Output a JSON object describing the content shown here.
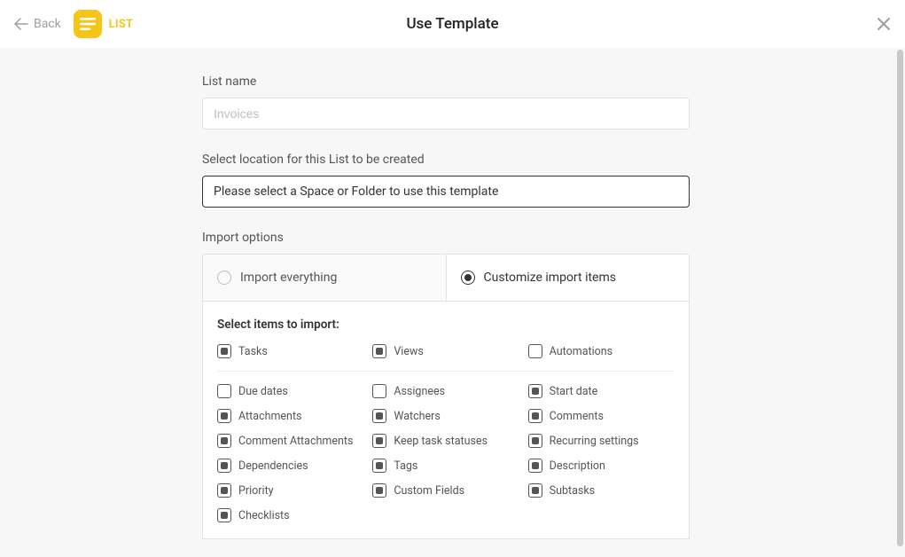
{
  "header": {
    "back_label": "Back",
    "chip_label": "LIST",
    "title": "Use Template"
  },
  "form": {
    "list_name_label": "List name",
    "list_name_placeholder": "Invoices",
    "location_label": "Select location for this List to be created",
    "location_placeholder": "Please select a Space or Folder to use this template"
  },
  "import": {
    "options_label": "Import options",
    "everything_label": "Import everything",
    "customize_label": "Customize import items",
    "select_items_label": "Select items to import:",
    "top_row": [
      {
        "label": "Tasks",
        "checked": true
      },
      {
        "label": "Views",
        "checked": true
      },
      {
        "label": "Automations",
        "checked": false
      }
    ],
    "cols": [
      [
        {
          "label": "Due dates",
          "checked": false
        },
        {
          "label": "Attachments",
          "checked": true
        },
        {
          "label": "Comment Attachments",
          "checked": true
        },
        {
          "label": "Dependencies",
          "checked": true
        },
        {
          "label": "Priority",
          "checked": true
        },
        {
          "label": "Checklists",
          "checked": true
        }
      ],
      [
        {
          "label": "Assignees",
          "checked": false
        },
        {
          "label": "Watchers",
          "checked": true
        },
        {
          "label": "Keep task statuses",
          "checked": true
        },
        {
          "label": "Tags",
          "checked": true
        },
        {
          "label": "Custom Fields",
          "checked": true
        }
      ],
      [
        {
          "label": "Start date",
          "checked": true
        },
        {
          "label": "Comments",
          "checked": true
        },
        {
          "label": "Recurring settings",
          "checked": true
        },
        {
          "label": "Description",
          "checked": true
        },
        {
          "label": "Subtasks",
          "checked": true
        }
      ]
    ]
  }
}
